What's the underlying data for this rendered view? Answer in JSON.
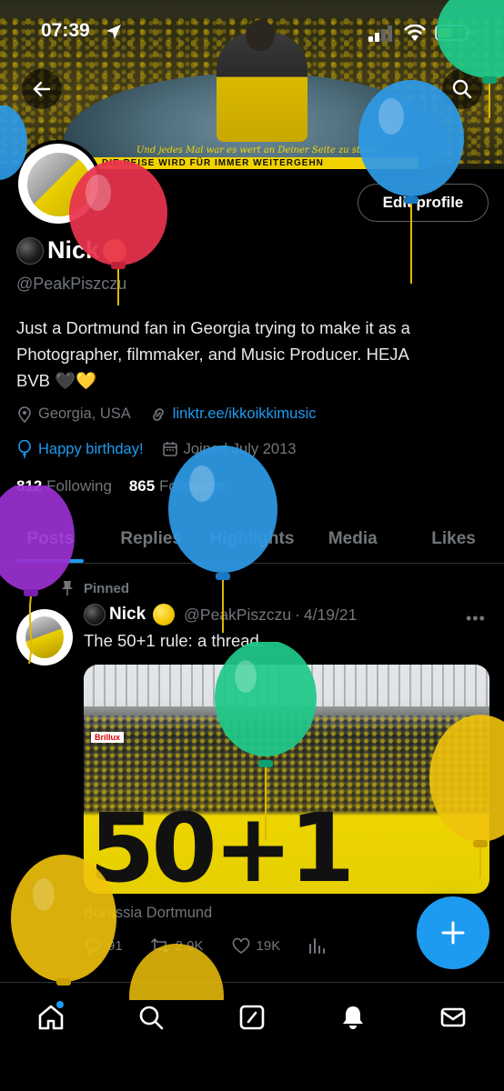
{
  "status_bar": {
    "time": "07:39"
  },
  "banner": {
    "script_text": "Und jedes Mal war es wert an Deiner Seite zu stehn",
    "strip_text": "DIE REISE WIRD FÜR IMMER WEITERGEHN"
  },
  "header": {
    "back_icon": "back-arrow-icon",
    "search_icon": "search-icon"
  },
  "profile": {
    "name": "Nick",
    "handle": "@PeakPiszczu",
    "edit_button": "Edit profile",
    "bio_line1": "Just a Dortmund fan in Georgia trying to make it as a",
    "bio_line2": "Photographer, filmmaker, and Music Producer. HEJA",
    "bio_line3": "BVB 🖤💛",
    "location": "Georgia, USA",
    "website": "linktr.ee/ikkoikkimusic",
    "birthday": "Happy birthday!",
    "joined": "Joined July 2013",
    "following_count": "812",
    "following_label": "Following",
    "followers_count": "865",
    "followers_label": "Followers"
  },
  "tabs": [
    {
      "label": "Posts",
      "active": true
    },
    {
      "label": "Replies",
      "active": false
    },
    {
      "label": "Highlights",
      "active": false
    },
    {
      "label": "Media",
      "active": false
    },
    {
      "label": "Likes",
      "active": false
    }
  ],
  "pinned_tweet": {
    "pinned_label": "Pinned",
    "author_name": "Nick",
    "author_handle": "@PeakPiszczu",
    "separator": "·",
    "date": "4/19/21",
    "more": "•••",
    "text": "The 50+1 rule: a thread.",
    "image_sign_text": "50+1",
    "image_ad_text": "Brillux",
    "caption": "Borussia Dortmund",
    "replies": "91",
    "retweets": "2.9K",
    "likes": "19K"
  },
  "fab": {
    "icon": "plus-icon"
  },
  "bottom_nav": [
    "home-icon",
    "search-icon",
    "compose-icon",
    "notifications-icon",
    "messages-icon"
  ],
  "colors": {
    "accent": "#1d9bf0",
    "background": "#000000",
    "muted": "#71767b",
    "text": "#e7e9ea"
  },
  "balloons": [
    {
      "color": "#2e9ae6"
    },
    {
      "color": "#1fc98a"
    },
    {
      "color": "#e8334f"
    },
    {
      "color": "#2e9ae6"
    },
    {
      "color": "#9a2fd0"
    },
    {
      "color": "#2e9ae6"
    },
    {
      "color": "#1fc98a"
    },
    {
      "color": "#f0c20c"
    },
    {
      "color": "#f0c20c"
    },
    {
      "color": "#f0c20c"
    }
  ]
}
